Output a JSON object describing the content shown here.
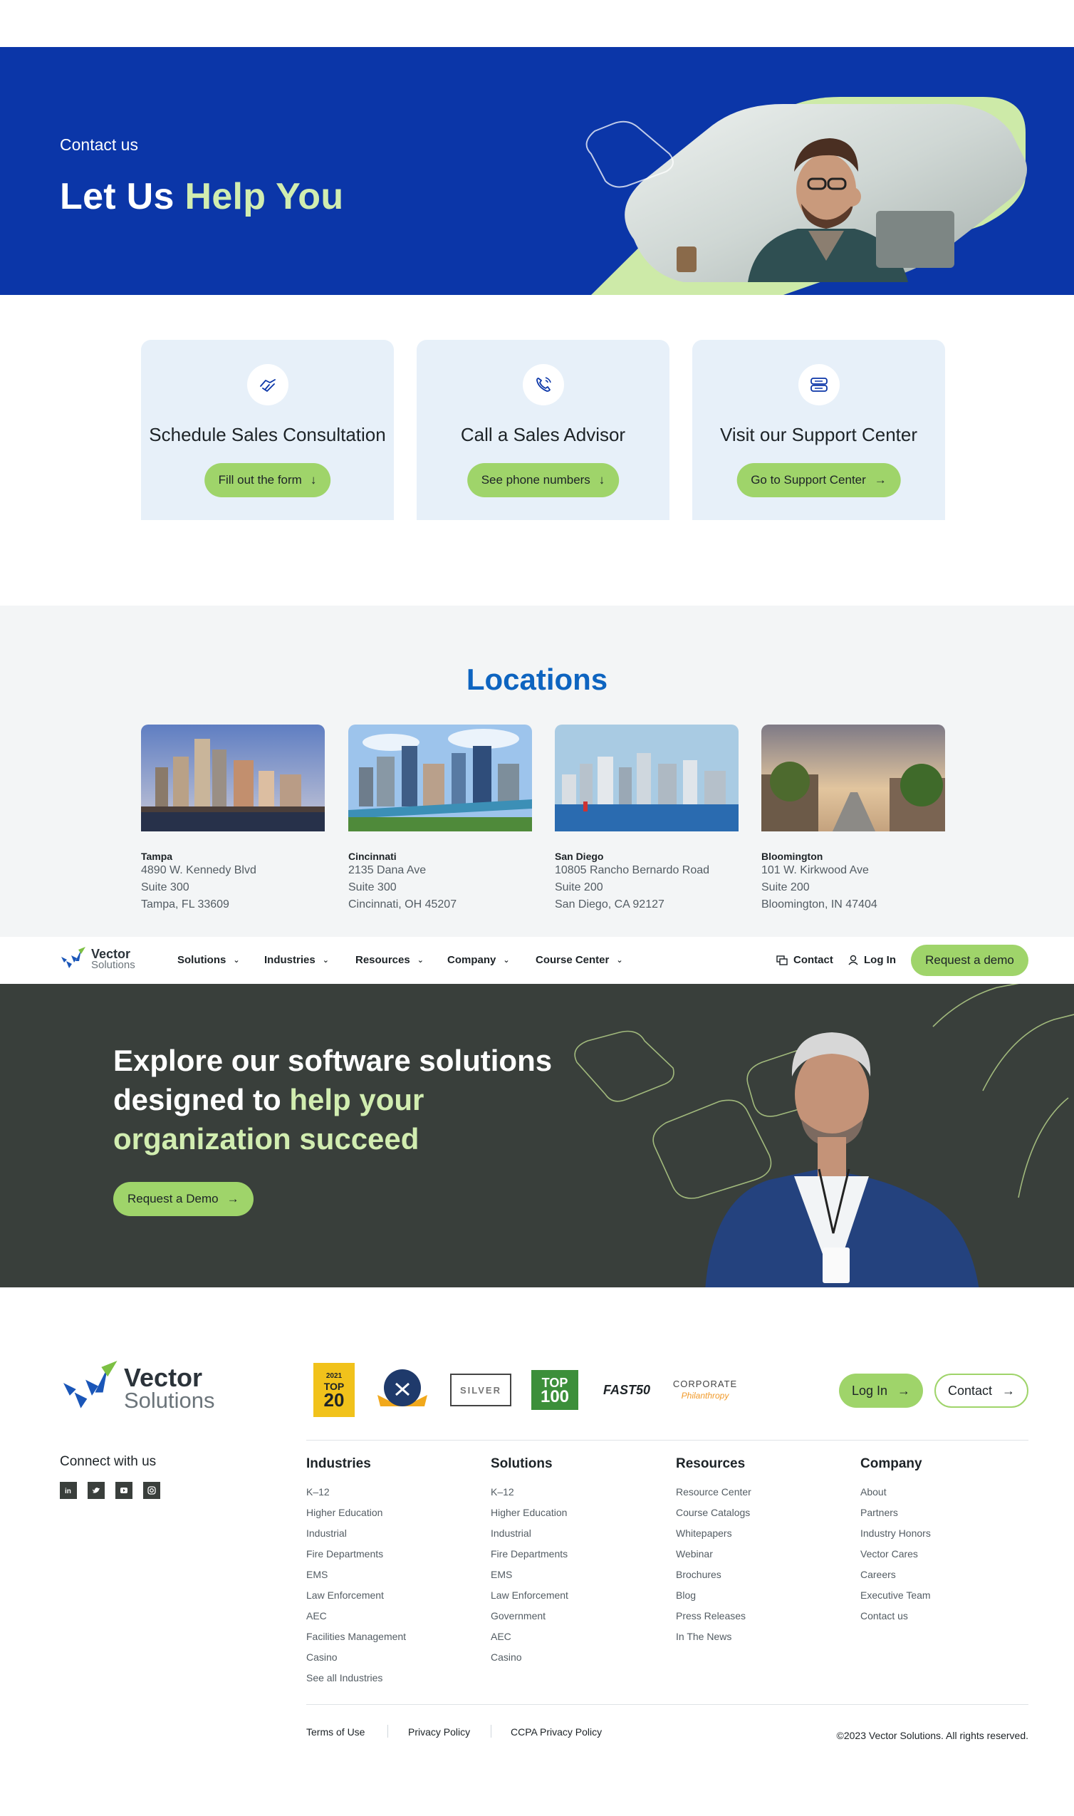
{
  "hero": {
    "kicker": "Contact us",
    "title_a": "Let Us ",
    "title_b": "Help You"
  },
  "cards": [
    {
      "title": "Schedule Sales Consultation",
      "button": "Fill out the form",
      "icon": "handshake-icon"
    },
    {
      "title": "Call a Sales Advisor",
      "button": "See phone numbers",
      "icon": "phone-icon"
    },
    {
      "title": "Visit our Support Center",
      "button": "Go to Support Center",
      "icon": "chat-support-icon"
    }
  ],
  "locations": {
    "title": "Locations",
    "items": [
      {
        "city": "Tampa",
        "line1": "4890 W. Kennedy Blvd",
        "line2": "Suite 300",
        "line3": "Tampa, FL 33609"
      },
      {
        "city": "Cincinnati",
        "line1": "2135 Dana Ave",
        "line2": "Suite 300",
        "line3": "Cincinnati, OH 45207"
      },
      {
        "city": "San Diego",
        "line1": "10805 Rancho Bernardo Road",
        "line2": "Suite 200",
        "line3": "San Diego, CA 92127"
      },
      {
        "city": "Bloomington",
        "line1": "101 W. Kirkwood Ave",
        "line2": "Suite 200",
        "line3": "Bloomington, IN 47404"
      }
    ]
  },
  "nav": {
    "logo_top": "Vector",
    "logo_bottom": "Solutions",
    "items": [
      "Solutions",
      "Industries",
      "Resources",
      "Company",
      "Course Center"
    ],
    "contact": "Contact",
    "login": "Log In",
    "demo": "Request a demo"
  },
  "explore": {
    "line1": "Explore our software solutions",
    "line2a": "designed to ",
    "line2b": "help your",
    "line3": "organization succeed",
    "button": "Request a Demo"
  },
  "footer": {
    "logo_top": "Vector",
    "logo_bottom": "Solutions",
    "awards": {
      "a1_top": "2021",
      "a1_mid": "TOP",
      "a1_num": "20",
      "a3": "SILVER",
      "a4_mid": "TOP",
      "a4_num": "100",
      "a5": "FAST50",
      "a6_top": "CORPORATE",
      "a6_bottom": "Philanthropy"
    },
    "login": "Log In",
    "contact": "Contact",
    "connect": "Connect with us",
    "columns": [
      {
        "title": "Industries",
        "links": [
          "K–12",
          "Higher Education",
          "Industrial",
          "Fire Departments",
          "EMS",
          "Law Enforcement",
          "AEC",
          "Facilities Management",
          "Casino",
          "See all Industries"
        ]
      },
      {
        "title": "Solutions",
        "links": [
          "K–12",
          "Higher Education",
          "Industrial",
          "Fire Departments",
          "EMS",
          "Law Enforcement",
          "Government",
          "AEC",
          "Casino"
        ]
      },
      {
        "title": "Resources",
        "links": [
          "Resource Center",
          "Course Catalogs",
          "Whitepapers",
          "Webinar",
          "Brochures",
          "Blog",
          "Press Releases",
          "In The News"
        ]
      },
      {
        "title": "Company",
        "links": [
          "About",
          "Partners",
          "Industry Honors",
          "Vector Cares",
          "Careers",
          "Executive Team",
          "Contact us"
        ]
      }
    ],
    "legal": [
      "Terms of Use",
      "Privacy Policy",
      "CCPA Privacy Policy"
    ],
    "copyright": "©2023 Vector Solutions. All rights reserved."
  },
  "colors": {
    "brand_blue": "#0b36a8",
    "accent_green": "#9fd46a",
    "highlight_green": "#d1edb0",
    "dark_band": "#393f3b",
    "locations_title": "#0d64c0"
  }
}
